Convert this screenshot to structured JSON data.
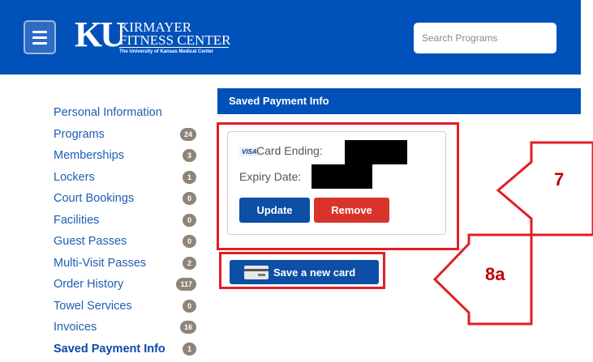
{
  "header": {
    "brand_mark": "KU",
    "brand_name_line1": "KIRMAYER",
    "brand_name_line2": "FITNESS CENTER",
    "brand_subtitle": "The University of Kansas Medical Center",
    "search_placeholder": "Search Programs",
    "colors": {
      "header_bg": "#0051ba"
    }
  },
  "sidebar": {
    "items": [
      {
        "label": "Personal Information",
        "badge": null
      },
      {
        "label": "Programs",
        "badge": "24"
      },
      {
        "label": "Memberships",
        "badge": "3"
      },
      {
        "label": "Lockers",
        "badge": "1"
      },
      {
        "label": "Court Bookings",
        "badge": "0"
      },
      {
        "label": "Facilities",
        "badge": "0"
      },
      {
        "label": "Guest Passes",
        "badge": "0"
      },
      {
        "label": "Multi-Visit Passes",
        "badge": "2"
      },
      {
        "label": "Order History",
        "badge": "117"
      },
      {
        "label": "Towel Services",
        "badge": "0"
      },
      {
        "label": "Invoices",
        "badge": "16"
      },
      {
        "label": "Saved Payment Info",
        "badge": "1",
        "active": true
      }
    ]
  },
  "main": {
    "title": "Saved Payment Info",
    "card": {
      "brand": "VISA",
      "ending_label": "Card Ending:",
      "expiry_label": "Expiry Date:",
      "update_label": "Update",
      "remove_label": "Remove"
    },
    "save_new_card_label": "Save a new card"
  },
  "annotations": {
    "callout_card": "7",
    "callout_save": "8a",
    "color": "#e31e24"
  }
}
